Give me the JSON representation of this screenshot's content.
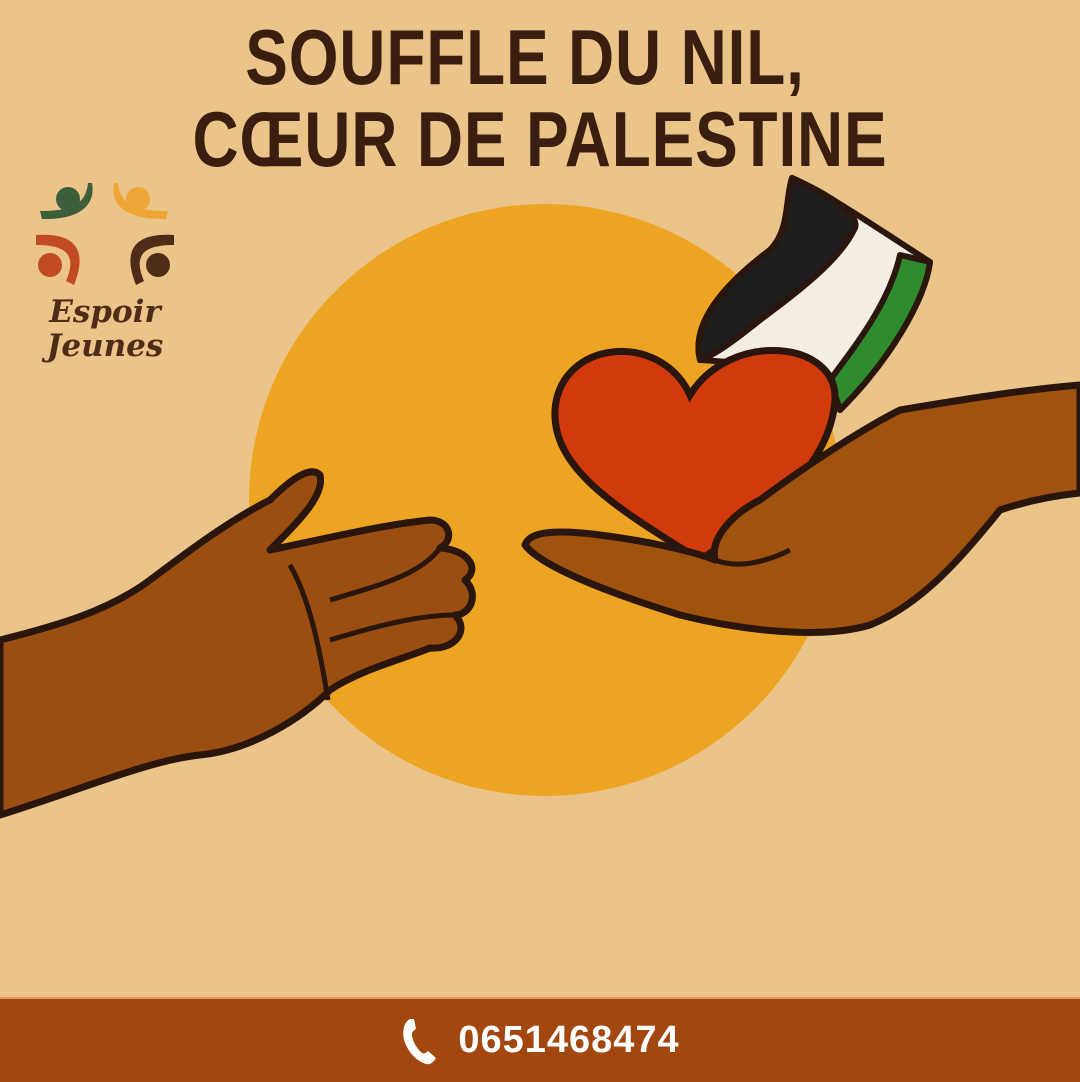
{
  "title": {
    "line1": "SOUFFLE DU NIL,",
    "line2": "CŒUR DE PALESTINE"
  },
  "logo": {
    "line1": "Espoir",
    "line2": "Jeunes"
  },
  "footer": {
    "icon": "phone-icon",
    "phone": "0651468474"
  },
  "colors": {
    "background": "#EAC488",
    "sun": "#EDA422",
    "heart": "#D13A0B",
    "footer": "#A1470F",
    "text": "#3A1F10"
  }
}
